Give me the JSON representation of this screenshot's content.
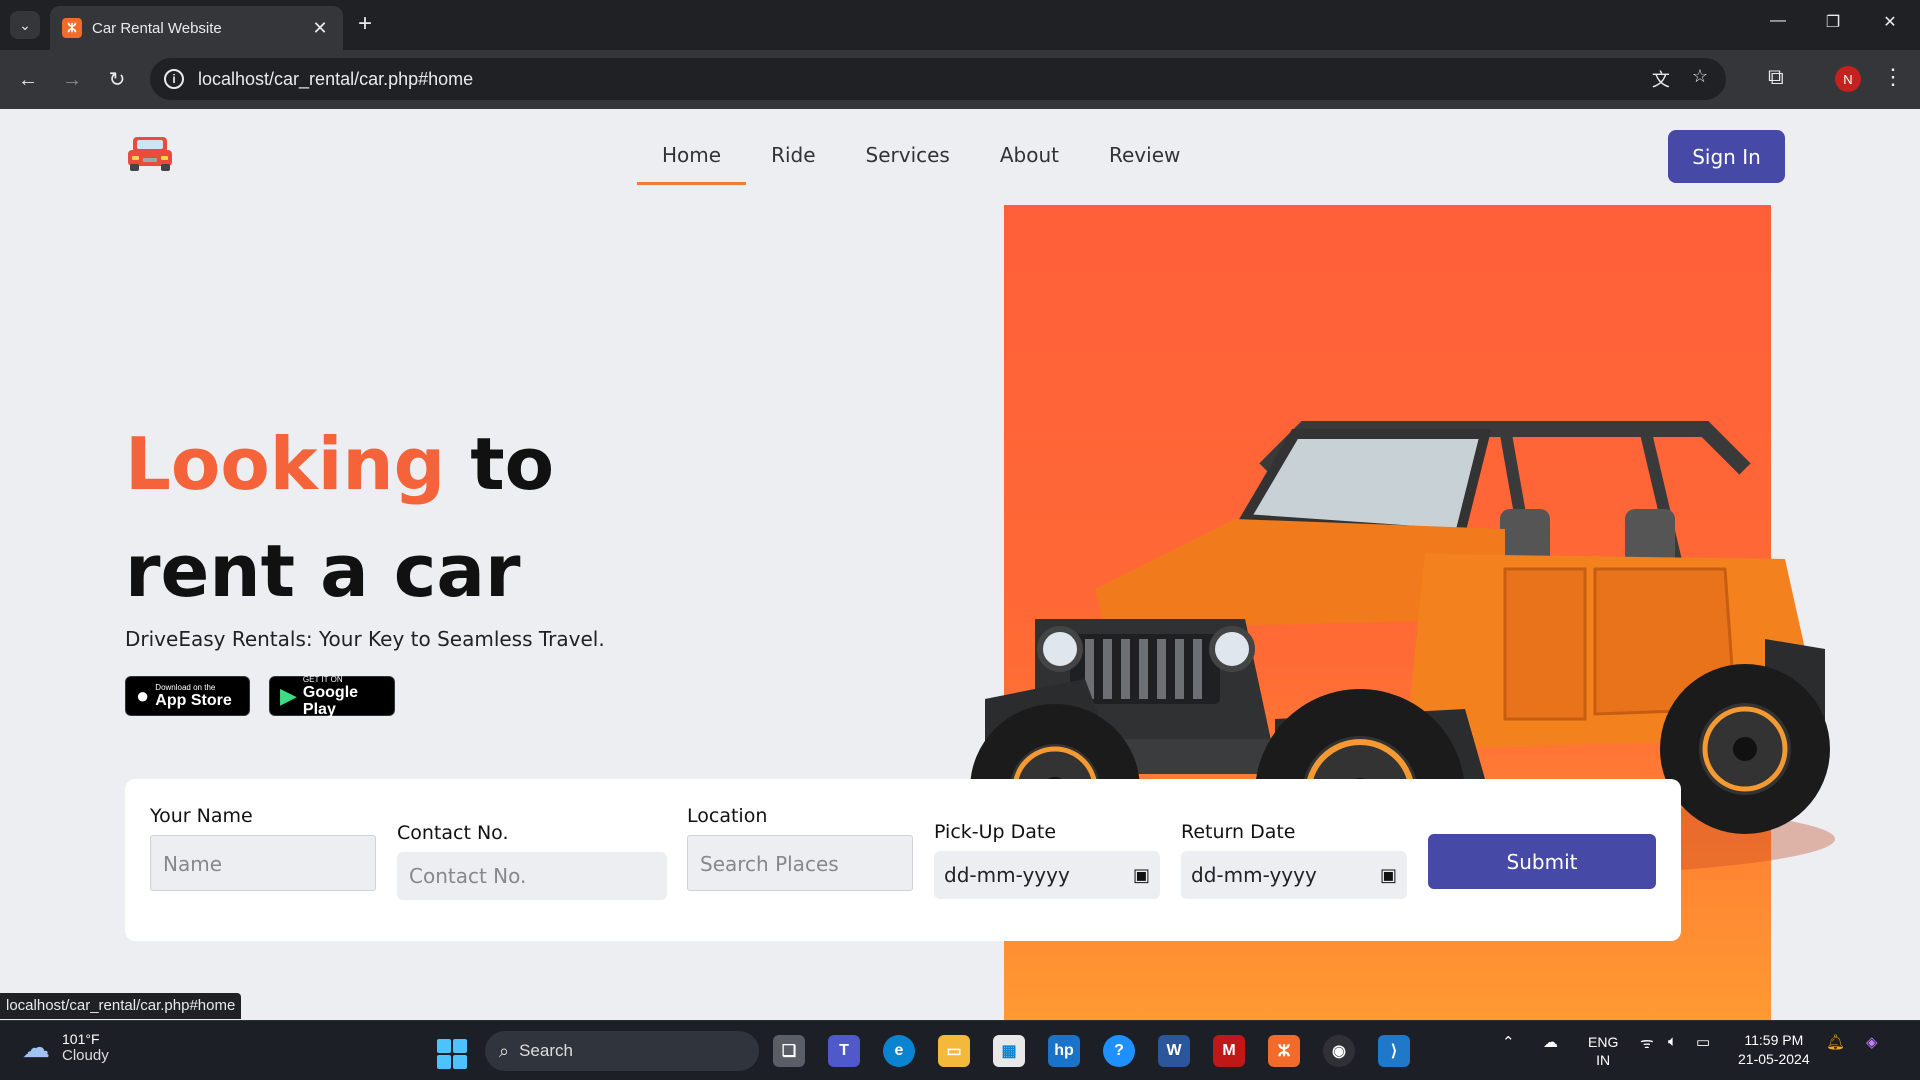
{
  "browser": {
    "tab_title": "Car Rental Website",
    "tab_favicon": "xampp-icon",
    "url": "localhost/car_rental/car.php#home",
    "profile_initial": "N",
    "status_url": "localhost/car_rental/car.php#home"
  },
  "site": {
    "logo": "car-logo-icon",
    "nav": [
      {
        "label": "Home",
        "active": true
      },
      {
        "label": "Ride"
      },
      {
        "label": "Services"
      },
      {
        "label": "About"
      },
      {
        "label": "Review"
      }
    ],
    "signin_label": "Sign In",
    "hero": {
      "headline_accent": "Looking",
      "headline_rest1": "to",
      "headline_rest2": "rent a car",
      "tagline": "DriveEasy Rentals: Your Key to Seamless Travel."
    },
    "badges": {
      "appstore_small": "Download on the",
      "appstore_big": "App Store",
      "googleplay_small": "GET IT ON",
      "googleplay_big": "Google Play"
    },
    "form": {
      "name_label": "Your Name",
      "name_placeholder": "Name",
      "contact_label": "Contact No.",
      "contact_placeholder": "Contact No.",
      "location_label": "Location",
      "location_placeholder": "Search Places",
      "pickup_label": "Pick-Up Date",
      "pickup_value": "dd-mm-yyyy",
      "return_label": "Return Date",
      "return_value": "dd-mm-yyyy",
      "submit_label": "Submit"
    },
    "colors": {
      "accent": "#f4633a",
      "primary_button": "#464aa6",
      "hero_orange": "#ff6a35"
    }
  },
  "taskbar": {
    "weather_temp": "101°F",
    "weather_desc": "Cloudy",
    "search_label": "Search",
    "lang_top": "ENG",
    "lang_bottom": "IN",
    "time": "11:59 PM",
    "date": "21-05-2024"
  }
}
